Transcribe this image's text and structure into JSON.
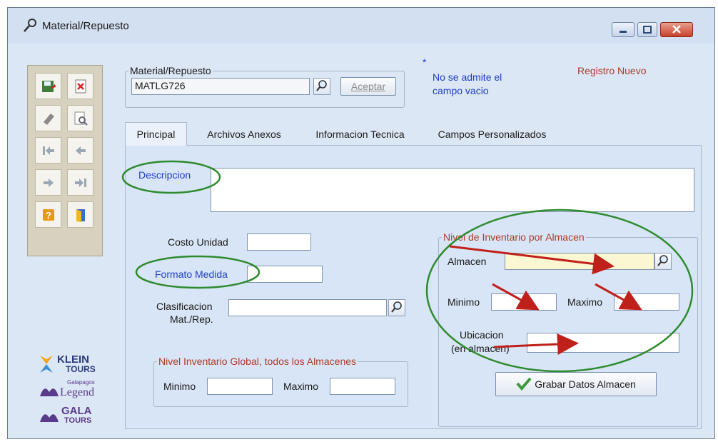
{
  "window": {
    "title": "Material/Repuesto",
    "controls": [
      "minimize",
      "maximize",
      "close"
    ]
  },
  "toolbar": {
    "buttons": [
      {
        "icon": "save-icon"
      },
      {
        "icon": "delete-icon"
      },
      {
        "icon": "eraser-icon"
      },
      {
        "icon": "preview-icon"
      },
      {
        "icon": "first-record-icon"
      },
      {
        "icon": "previous-record-icon"
      },
      {
        "icon": "next-record-icon"
      },
      {
        "icon": "last-record-icon"
      },
      {
        "icon": "help-icon"
      },
      {
        "icon": "exit-icon"
      }
    ]
  },
  "material": {
    "group_label": "Material/Repuesto",
    "code_value": "MATLG726",
    "accept_label": "Aceptar"
  },
  "notice": {
    "asterisk": "*",
    "line1": "No se admite el",
    "line2": "campo vacio",
    "status": "Registro Nuevo"
  },
  "tabs": [
    "Principal",
    "Archivos Anexos",
    "Informacion Tecnica",
    "Campos Personalizados"
  ],
  "principal": {
    "descripcion_label": "Descripcion",
    "descripcion_value": "",
    "costo_label": "Costo Unidad",
    "costo_value": "",
    "formato_label": "Formato Medida",
    "formato_value": "",
    "clasificacion_label1": "Clasificacion",
    "clasificacion_label2": "Mat./Rep.",
    "clasificacion_value": ""
  },
  "global": {
    "legend": "Nivel Inventario Global, todos  los Almacenes",
    "minimo_label": "Minimo",
    "maximo_label": "Maximo",
    "minimo_value": "",
    "maximo_value": ""
  },
  "almacen": {
    "legend": "Nivel de Inventario por Almacen",
    "almacen_label": "Almacen",
    "minimo_label": "Minimo",
    "maximo_label": "Maximo",
    "ubicacion_label1": "Ubicacion",
    "ubicacion_label2": "(en almacen)",
    "save_label": "Grabar Datos Almacen"
  },
  "logos": {
    "klein_line1": "KLEIN",
    "klein_line2": "TOURS",
    "legend_small": "Galapagos",
    "legend_word": "Legend",
    "gala_line1": "GALA",
    "gala_line2": "TOURS"
  },
  "colors": {
    "highlight_green": "#2e8b2e",
    "arrow_red": "#c0201a",
    "almacen_field": "#fbf7d2",
    "label_blue": "#1e3ec8",
    "status_red": "#b03a26"
  }
}
